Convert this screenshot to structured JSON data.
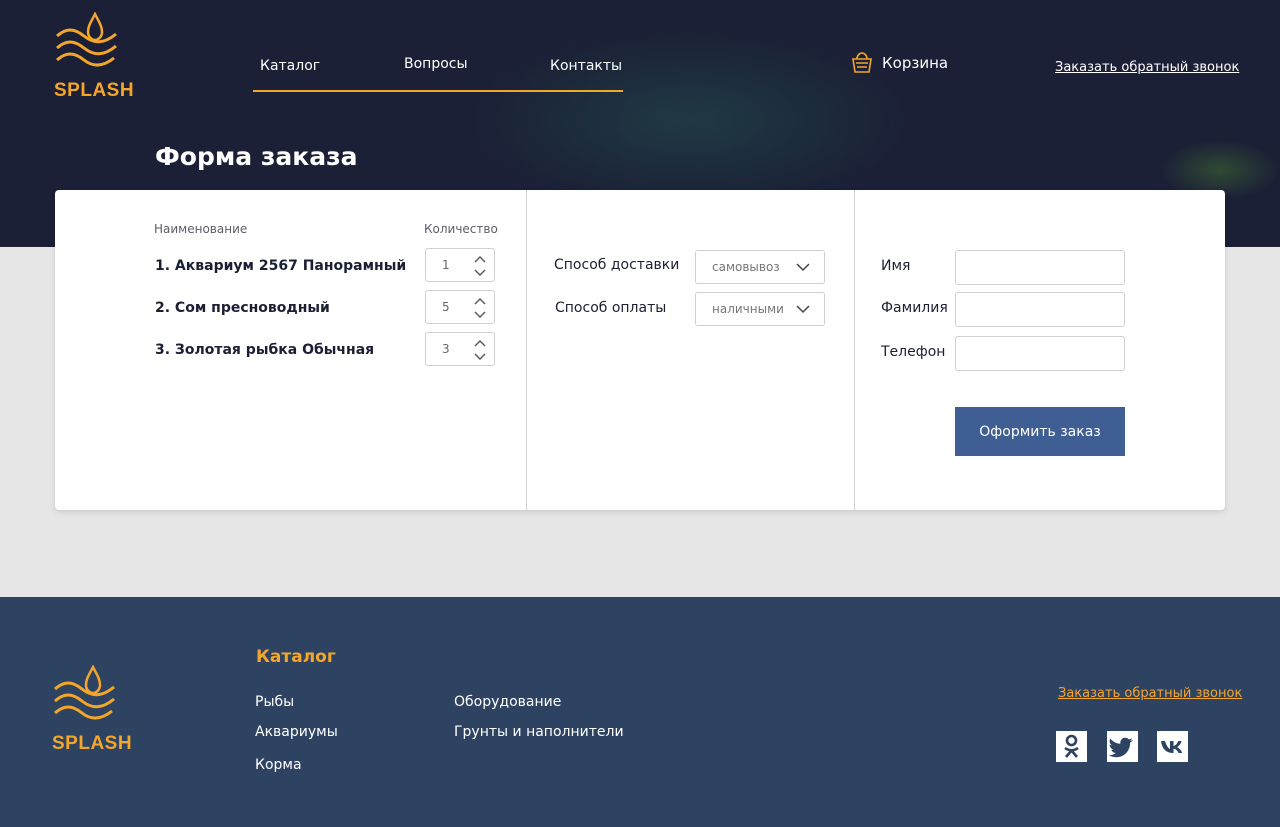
{
  "brand": {
    "name": "SPLASH",
    "accent": "#f4a62a"
  },
  "header": {
    "nav": [
      "Каталог",
      "Вопросы",
      "Контакты"
    ],
    "cart_label": "Корзина",
    "callback_label": "Заказать обратный звонок"
  },
  "page_title": "Форма заказа",
  "order": {
    "col_name": "Наименование",
    "col_qty": "Количество",
    "items": [
      {
        "label": "1. Аквариум 2567 Панорамный",
        "qty": "1"
      },
      {
        "label": "2. Сом пресноводный",
        "qty": "5"
      },
      {
        "label": "3. Золотая рыбка Обычная",
        "qty": "3"
      }
    ]
  },
  "delivery": {
    "delivery_label": "Способ доставки",
    "delivery_value": "самовывоз",
    "payment_label": "Способ оплаты",
    "payment_value": "наличными"
  },
  "customer": {
    "name_label": "Имя",
    "surname_label": "Фамилия",
    "phone_label": "Телефон",
    "name_value": "",
    "surname_value": "",
    "phone_value": "",
    "submit_label": "Оформить заказ"
  },
  "footer": {
    "catalog_title": "Каталог",
    "links": [
      "Рыбы",
      "Аквариумы",
      "Корма",
      "Оборудование",
      "Грунты и наполнители"
    ],
    "callback_label": "Заказать обратный звонок",
    "social_icons": [
      "odnoklassniki-icon",
      "twitter-icon",
      "vk-icon"
    ]
  },
  "colors": {
    "header_bg": "#1b2036",
    "footer_bg": "#2e4361",
    "button_bg": "#3f5f94",
    "page_bg": "#e6e6e6"
  }
}
